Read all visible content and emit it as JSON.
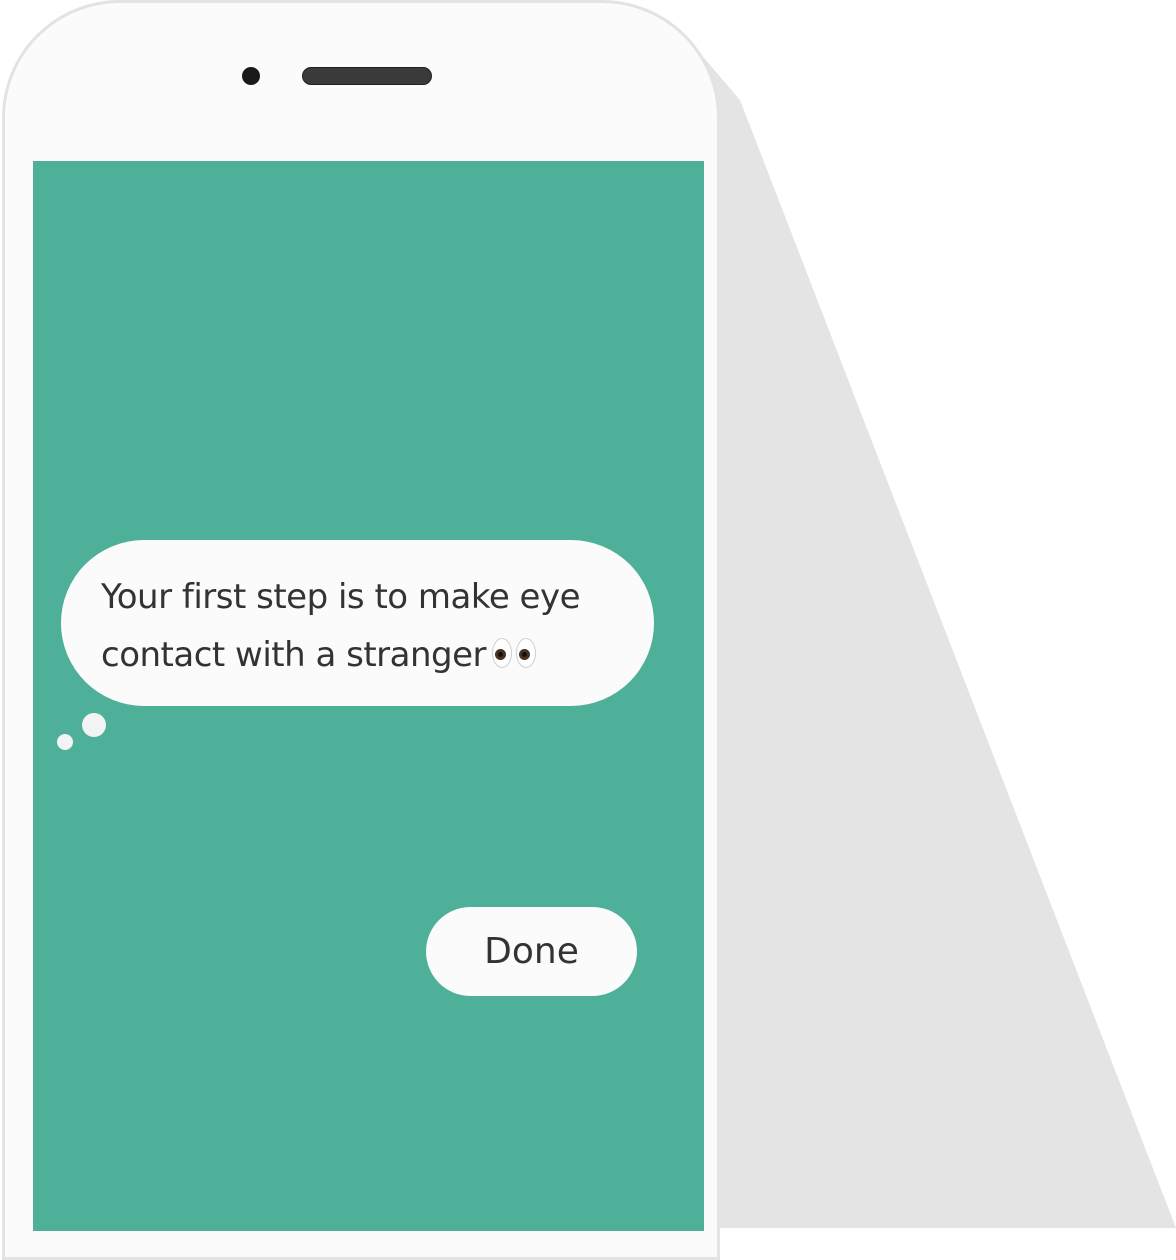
{
  "message": {
    "line1": "Your first step is to make eye",
    "line2": "contact with a stranger",
    "emoji": "eyes-icon"
  },
  "actions": {
    "done_label": "Done"
  },
  "colors": {
    "screen_background": "#4eb099",
    "bubble_background": "#fbfbfb",
    "text": "#333333",
    "phone_frame": "#fbfbfb",
    "shadow": "#e4e4e4"
  }
}
